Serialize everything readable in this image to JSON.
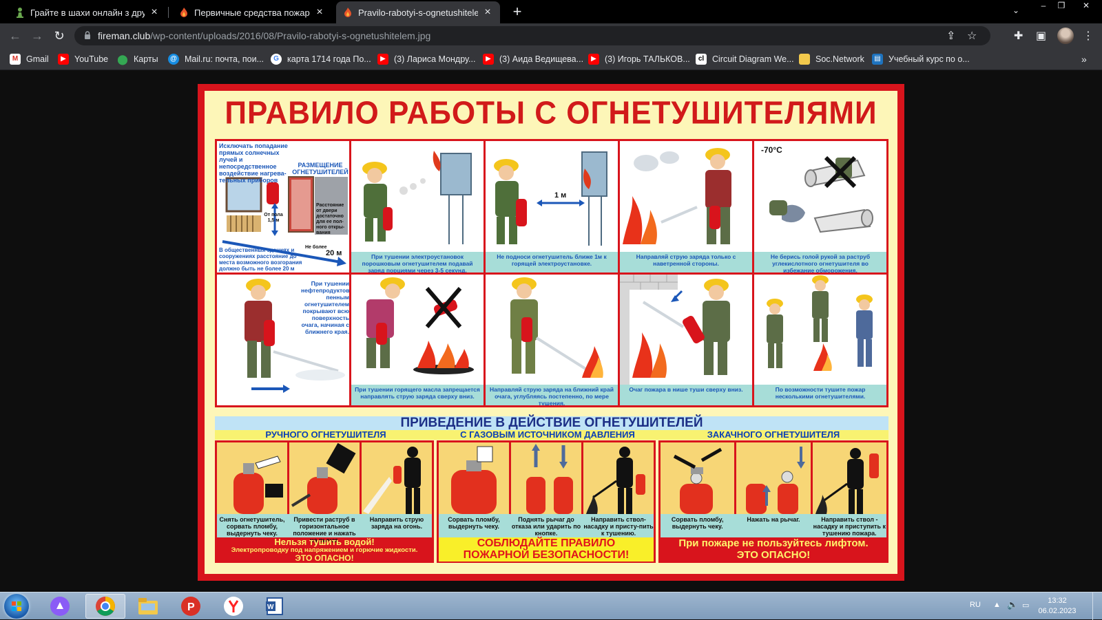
{
  "tabs": [
    {
      "title": "Грайте в шахи онлайн з друзями",
      "icon": "chess-pawn-icon"
    },
    {
      "title": "Первичные средства пожаротушения",
      "icon": "flame-icon"
    },
    {
      "title": "Pravilo-rabotyi-s-ognetushitelem.jpg",
      "icon": "flame-icon"
    }
  ],
  "address": {
    "host": "fireman.club",
    "path": "/wp-content/uploads/2016/08/Pravilo-rabotyi-s-ognetushitelem.jpg"
  },
  "bookmarks": [
    {
      "label": "Gmail",
      "icon": "gmail-icon"
    },
    {
      "label": "YouTube",
      "icon": "youtube-icon"
    },
    {
      "label": "Карты",
      "icon": "maps-pin-icon"
    },
    {
      "label": "Mail.ru: почта, пои...",
      "icon": "mailru-icon"
    },
    {
      "label": "карта 1714 года По...",
      "icon": "google-icon"
    },
    {
      "label": "(3) Лариса Мондру...",
      "icon": "youtube-icon"
    },
    {
      "label": "(3) Аида Ведищева...",
      "icon": "youtube-icon"
    },
    {
      "label": "(3) Игорь ТАЛЬКОВ...",
      "icon": "youtube-icon"
    },
    {
      "label": "Circuit Diagram We...",
      "icon": "circuit-icon"
    },
    {
      "label": "Soc.Network",
      "icon": "folder-icon"
    },
    {
      "label": "Учебный курс по о...",
      "icon": "course-icon"
    }
  ],
  "poster": {
    "title": "ПРАВИЛО РАБОТЫ С ОГНЕТУШИТЕЛЯМИ",
    "cell1": {
      "top_text": "Исключать попадание прямых солнечных лучей и непосредственное воздействие нагрева-тельных приборов",
      "heading": "РАЗМЕЩЕНИЕ ОГНЕТУШИТЕЛЕЙ",
      "height_note": "От пола 1,5 м",
      "door_note": "Расстояние от двери достаточно для ее пол-ного откры-вания",
      "distance_note": "Не более",
      "distance_value": "20 м",
      "bottom_text": "В общественных зданиях и сооружениях расстояние до места возможного возгорания должно быть не более 20 м"
    },
    "cells": [
      {
        "caption": "При тушении электроустановок порошковым огнетушителем подавай заряд порциями через 3-5 секунд."
      },
      {
        "caption": "Не подноси огнетушитель ближе 1м к горящей электроустановке.",
        "label": "1 м"
      },
      {
        "caption": "Направляй струю заряда только с наветренной стороны."
      },
      {
        "caption": "Не берись голой рукой за раструб углекислотного огнетушителя во избежание обморожения.",
        "label": "-70°С"
      },
      {
        "caption": "",
        "side_text": "При тушении нефтепродуктов пенным огнетушителем покрывают всю поверхность очага, начиная с ближнего края."
      },
      {
        "caption": "При тушении горящего масла запрещается направлять струю заряда сверху вниз."
      },
      {
        "caption": "Направляй струю заряда на ближний край очага, углубляясь постепенно, по мере тушения."
      },
      {
        "caption": "Очаг пожара в нише туши сверху вниз."
      },
      {
        "caption": "По возможности тушите пожар несколькими огнетушителями."
      }
    ],
    "section_title": "ПРИВЕДЕНИЕ В ДЕЙСТВИЕ ОГНЕТУШИТЕЛЕЙ",
    "groups": [
      {
        "title": "РУЧНОГО ОГНЕТУШИТЕЛЯ",
        "captions": [
          "Снять огнетушитель, сорвать пломбу, выдернуть чеку.",
          "Привести раструб в горизонтальное положение и нажать на рычаг.",
          "Направить струю заряда на огонь."
        ],
        "warn1": "Нельзя тушить водой!",
        "warn2": "Электропроводку под напряжением и горючие жидкости.",
        "warn3": "ЭТО ОПАСНО!"
      },
      {
        "title": "С ГАЗОВЫМ ИСТОЧНИКОМ ДАВЛЕНИЯ",
        "captions": [
          "Сорвать пломбу, выдернуть чеку.",
          "Поднять рычаг до отказа или ударить по кнопке.",
          "Направить ствол-насадку и присту-пить к тушению."
        ],
        "warn1": "СОБЛЮДАЙТЕ ПРАВИЛО",
        "warn2": "ПОЖАРНОЙ БЕЗОПАСНОСТИ!"
      },
      {
        "title": "ЗАКАЧНОГО ОГНЕТУШИТЕЛЯ",
        "captions": [
          "Сорвать пломбу, выдернуть чеку.",
          "Нажать на рычаг.",
          "Направить ствол - насадку и приступить к тушению пожара."
        ],
        "warn1": "При пожаре не пользуйтесь лифтом.",
        "warn2": "ЭТО ОПАСНО!"
      }
    ]
  },
  "taskbar": {
    "language": "RU",
    "time": "13:32",
    "date": "06.02.2023",
    "apps": [
      "start-orb",
      "alice-icon",
      "chrome-icon",
      "explorer-icon",
      "presenter-icon",
      "yandex-icon",
      "word-icon"
    ]
  },
  "colors": {
    "poster_red": "#d8141c",
    "poster_yellow": "#fdf6b8",
    "caption_teal": "#a7ddd8",
    "caption_blue": "#1b57b8"
  }
}
